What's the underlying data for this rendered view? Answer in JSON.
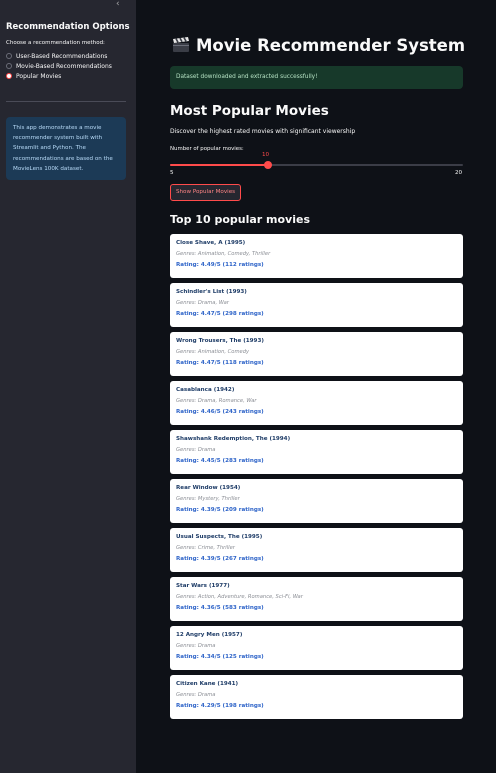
{
  "sidebar": {
    "title": "Recommendation Options",
    "method_label": "Choose a recommendation method:",
    "options": [
      {
        "label": "User-Based Recommendations",
        "selected": false
      },
      {
        "label": "Movie-Based Recommendations",
        "selected": false
      },
      {
        "label": "Popular Movies",
        "selected": true
      }
    ],
    "info_text": "This app demonstrates a movie recommender system built with Streamlit and Python. The recommendations are based on the MovieLens 100K dataset."
  },
  "main": {
    "title": "Movie Recommender System",
    "title_icon": "clapperboard-icon",
    "success_message": "Dataset downloaded and extracted successfully!",
    "section_title": "Most Popular Movies",
    "section_desc": "Discover the highest rated movies with significant viewership",
    "slider": {
      "label": "Number of popular movies:",
      "value": 10,
      "min": 5,
      "max": 20
    },
    "button_label": "Show Popular Movies",
    "results_title": "Top 10 popular movies",
    "movies": [
      {
        "title": "Close Shave, A (1995)",
        "genres": "Genres: Animation, Comedy, Thriller",
        "rating": "Rating: 4.49/5 (112 ratings)"
      },
      {
        "title": "Schindler's List (1993)",
        "genres": "Genres: Drama, War",
        "rating": "Rating: 4.47/5 (298 ratings)"
      },
      {
        "title": "Wrong Trousers, The (1993)",
        "genres": "Genres: Animation, Comedy",
        "rating": "Rating: 4.47/5 (118 ratings)"
      },
      {
        "title": "Casablanca (1942)",
        "genres": "Genres: Drama, Romance, War",
        "rating": "Rating: 4.46/5 (243 ratings)"
      },
      {
        "title": "Shawshank Redemption, The (1994)",
        "genres": "Genres: Drama",
        "rating": "Rating: 4.45/5 (283 ratings)"
      },
      {
        "title": "Rear Window (1954)",
        "genres": "Genres: Mystery, Thriller",
        "rating": "Rating: 4.39/5 (209 ratings)"
      },
      {
        "title": "Usual Suspects, The (1995)",
        "genres": "Genres: Crime, Thriller",
        "rating": "Rating: 4.39/5 (267 ratings)"
      },
      {
        "title": "Star Wars (1977)",
        "genres": "Genres: Action, Adventure, Romance, Sci-Fi, War",
        "rating": "Rating: 4.36/5 (583 ratings)"
      },
      {
        "title": "12 Angry Men (1957)",
        "genres": "Genres: Drama",
        "rating": "Rating: 4.34/5 (125 ratings)"
      },
      {
        "title": "Citizen Kane (1941)",
        "genres": "Genres: Drama",
        "rating": "Rating: 4.29/5 (198 ratings)"
      }
    ]
  },
  "colors": {
    "accent": "#ff4b4b",
    "background": "#0e1117",
    "sidebar": "#262730",
    "success_bg": "#17392a",
    "info_bg": "#1c3a56",
    "rating_text": "#2d63c8"
  }
}
